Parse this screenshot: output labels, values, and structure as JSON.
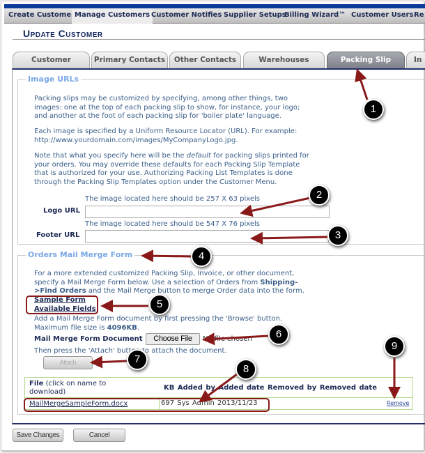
{
  "nav": {
    "items": [
      "Create Customer",
      "Manage Customers",
      "Customer Notifies",
      "Supplier Setups",
      "Billing Wizard™",
      "Customer Users",
      "Re"
    ],
    "active": 1
  },
  "page_title": "Update Customer",
  "tabs": [
    "Customer",
    "Primary Contacts",
    "Other Contacts",
    "Warehouses",
    "Packing Slip",
    "In"
  ],
  "selected_tab": "Packing Slip",
  "image_urls": {
    "legend": "Image URLs",
    "para1": [
      "Packing slips may be customized by specifying, among other things, two",
      "images: one at the top of each packing slip to show, for instance, your logo;",
      "and another at the foot of each packing slip for 'boiler plate' language."
    ],
    "para2": [
      "Each image is specified by a Uniform Resource Locator (URL). For example:",
      "http://www.yourdomain.com/images/MyCompanyLogo.jpg."
    ],
    "para3_a": "Note that what you specify here will be the ",
    "para3_em": "default",
    "para3_b": " for packing slips printed for",
    "para3_rest": [
      "your orders. You may override these defaults for each Packing Slip Template",
      "that is authorized for your use. Authorizing Packing List Templates is done",
      "through the Packing Slip Templates option under the Customer Menu."
    ],
    "logo_hint": "The image located here should be 257 X 63 pixels",
    "logo_label": "Logo URL",
    "logo_value": "",
    "footer_hint": "The image located here should be 547 X 76 pixels",
    "footer_label": "Footer URL",
    "footer_value": ""
  },
  "mail_merge": {
    "legend": "Orders Mail Merge Form",
    "intro1": "For a more extended customized Packing Slip, Invoice, or other document,",
    "intro2a": "specify a Mail Merge Form below. Use a selection of Orders from ",
    "intro2b": "Shipping-",
    "intro3a": ">Find Orders",
    "intro3b": " and the Mail Merge button to merge Order data into the form.",
    "sample_form": "Sample Form",
    "available_fields": "Available Fields",
    "add1": "Add a Mail Merge Form document by first pressing the 'Browse' button.",
    "add2a": "Maximum file size is ",
    "add2b": "4096KB",
    ".": ".",
    "doc_label": "Mail Merge Form Document",
    "choose_file": "Choose File",
    "no_file": "No file chosen",
    "then": "Then press the 'Attach' button to attach the document.",
    "attach": "Attach",
    "table": {
      "file_header_bold": "File",
      "file_header_rest": " (click on name to download)",
      "headers": [
        "KB",
        "Added by",
        "Added date",
        "Removed by",
        "Removed date"
      ],
      "rows": [
        {
          "file": "MailMergeSampleForm.docx",
          "kb": "697",
          "added_by": "Sys Admin",
          "added_date": "2013/11/23",
          "removed_by": "",
          "removed_date": "",
          "action": "Remove"
        }
      ]
    }
  },
  "buttons": {
    "save": "Save Changes",
    "cancel": "Cancel"
  },
  "annotations": [
    "1",
    "2",
    "3",
    "4",
    "5",
    "6",
    "7",
    "8",
    "9"
  ],
  "colors": {
    "nav_blue": "#0a3a9a",
    "legend": "#7aa8e6",
    "annotation_arrow": "#8a1a1a",
    "text": "#3b5f8a"
  }
}
